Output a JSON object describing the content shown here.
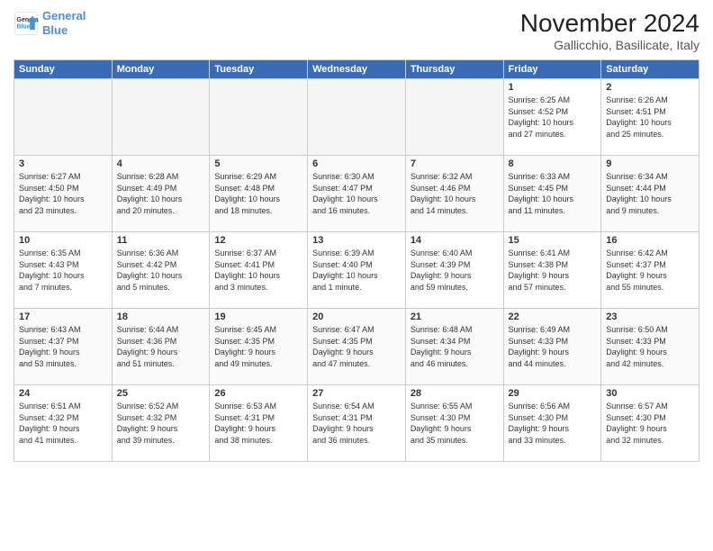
{
  "logo": {
    "line1": "General",
    "line2": "Blue"
  },
  "title": "November 2024",
  "location": "Gallicchio, Basilicate, Italy",
  "weekdays": [
    "Sunday",
    "Monday",
    "Tuesday",
    "Wednesday",
    "Thursday",
    "Friday",
    "Saturday"
  ],
  "weeks": [
    [
      {
        "day": "",
        "info": ""
      },
      {
        "day": "",
        "info": ""
      },
      {
        "day": "",
        "info": ""
      },
      {
        "day": "",
        "info": ""
      },
      {
        "day": "",
        "info": ""
      },
      {
        "day": "1",
        "info": "Sunrise: 6:25 AM\nSunset: 4:52 PM\nDaylight: 10 hours\nand 27 minutes."
      },
      {
        "day": "2",
        "info": "Sunrise: 6:26 AM\nSunset: 4:51 PM\nDaylight: 10 hours\nand 25 minutes."
      }
    ],
    [
      {
        "day": "3",
        "info": "Sunrise: 6:27 AM\nSunset: 4:50 PM\nDaylight: 10 hours\nand 23 minutes."
      },
      {
        "day": "4",
        "info": "Sunrise: 6:28 AM\nSunset: 4:49 PM\nDaylight: 10 hours\nand 20 minutes."
      },
      {
        "day": "5",
        "info": "Sunrise: 6:29 AM\nSunset: 4:48 PM\nDaylight: 10 hours\nand 18 minutes."
      },
      {
        "day": "6",
        "info": "Sunrise: 6:30 AM\nSunset: 4:47 PM\nDaylight: 10 hours\nand 16 minutes."
      },
      {
        "day": "7",
        "info": "Sunrise: 6:32 AM\nSunset: 4:46 PM\nDaylight: 10 hours\nand 14 minutes."
      },
      {
        "day": "8",
        "info": "Sunrise: 6:33 AM\nSunset: 4:45 PM\nDaylight: 10 hours\nand 11 minutes."
      },
      {
        "day": "9",
        "info": "Sunrise: 6:34 AM\nSunset: 4:44 PM\nDaylight: 10 hours\nand 9 minutes."
      }
    ],
    [
      {
        "day": "10",
        "info": "Sunrise: 6:35 AM\nSunset: 4:43 PM\nDaylight: 10 hours\nand 7 minutes."
      },
      {
        "day": "11",
        "info": "Sunrise: 6:36 AM\nSunset: 4:42 PM\nDaylight: 10 hours\nand 5 minutes."
      },
      {
        "day": "12",
        "info": "Sunrise: 6:37 AM\nSunset: 4:41 PM\nDaylight: 10 hours\nand 3 minutes."
      },
      {
        "day": "13",
        "info": "Sunrise: 6:39 AM\nSunset: 4:40 PM\nDaylight: 10 hours\nand 1 minute."
      },
      {
        "day": "14",
        "info": "Sunrise: 6:40 AM\nSunset: 4:39 PM\nDaylight: 9 hours\nand 59 minutes."
      },
      {
        "day": "15",
        "info": "Sunrise: 6:41 AM\nSunset: 4:38 PM\nDaylight: 9 hours\nand 57 minutes."
      },
      {
        "day": "16",
        "info": "Sunrise: 6:42 AM\nSunset: 4:37 PM\nDaylight: 9 hours\nand 55 minutes."
      }
    ],
    [
      {
        "day": "17",
        "info": "Sunrise: 6:43 AM\nSunset: 4:37 PM\nDaylight: 9 hours\nand 53 minutes."
      },
      {
        "day": "18",
        "info": "Sunrise: 6:44 AM\nSunset: 4:36 PM\nDaylight: 9 hours\nand 51 minutes."
      },
      {
        "day": "19",
        "info": "Sunrise: 6:45 AM\nSunset: 4:35 PM\nDaylight: 9 hours\nand 49 minutes."
      },
      {
        "day": "20",
        "info": "Sunrise: 6:47 AM\nSunset: 4:35 PM\nDaylight: 9 hours\nand 47 minutes."
      },
      {
        "day": "21",
        "info": "Sunrise: 6:48 AM\nSunset: 4:34 PM\nDaylight: 9 hours\nand 46 minutes."
      },
      {
        "day": "22",
        "info": "Sunrise: 6:49 AM\nSunset: 4:33 PM\nDaylight: 9 hours\nand 44 minutes."
      },
      {
        "day": "23",
        "info": "Sunrise: 6:50 AM\nSunset: 4:33 PM\nDaylight: 9 hours\nand 42 minutes."
      }
    ],
    [
      {
        "day": "24",
        "info": "Sunrise: 6:51 AM\nSunset: 4:32 PM\nDaylight: 9 hours\nand 41 minutes."
      },
      {
        "day": "25",
        "info": "Sunrise: 6:52 AM\nSunset: 4:32 PM\nDaylight: 9 hours\nand 39 minutes."
      },
      {
        "day": "26",
        "info": "Sunrise: 6:53 AM\nSunset: 4:31 PM\nDaylight: 9 hours\nand 38 minutes."
      },
      {
        "day": "27",
        "info": "Sunrise: 6:54 AM\nSunset: 4:31 PM\nDaylight: 9 hours\nand 36 minutes."
      },
      {
        "day": "28",
        "info": "Sunrise: 6:55 AM\nSunset: 4:30 PM\nDaylight: 9 hours\nand 35 minutes."
      },
      {
        "day": "29",
        "info": "Sunrise: 6:56 AM\nSunset: 4:30 PM\nDaylight: 9 hours\nand 33 minutes."
      },
      {
        "day": "30",
        "info": "Sunrise: 6:57 AM\nSunset: 4:30 PM\nDaylight: 9 hours\nand 32 minutes."
      }
    ]
  ]
}
